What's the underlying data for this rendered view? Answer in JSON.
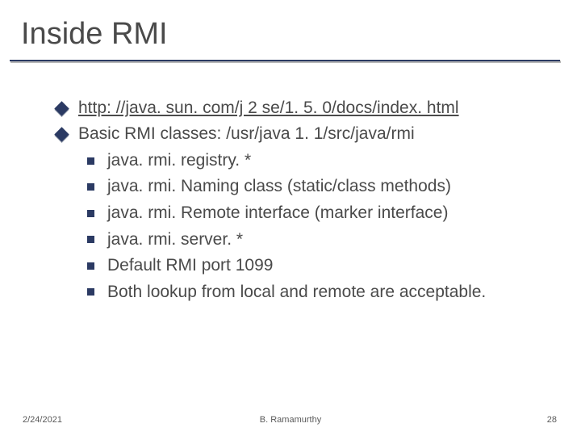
{
  "title": "Inside RMI",
  "bullets": {
    "link": "http: //java. sun. com/j 2 se/1. 5. 0/docs/index. html",
    "basic": "Basic RMI classes: /usr/java 1. 1/src/java/rmi",
    "sub": [
      "java. rmi. registry. *",
      "java. rmi. Naming class (static/class methods)",
      "java. rmi. Remote interface (marker interface)",
      "java. rmi. server. *",
      "Default RMI port 1099",
      "Both lookup from local and remote are acceptable."
    ]
  },
  "footer": {
    "date": "2/24/2021",
    "author": "B. Ramamurthy",
    "page": "28"
  }
}
